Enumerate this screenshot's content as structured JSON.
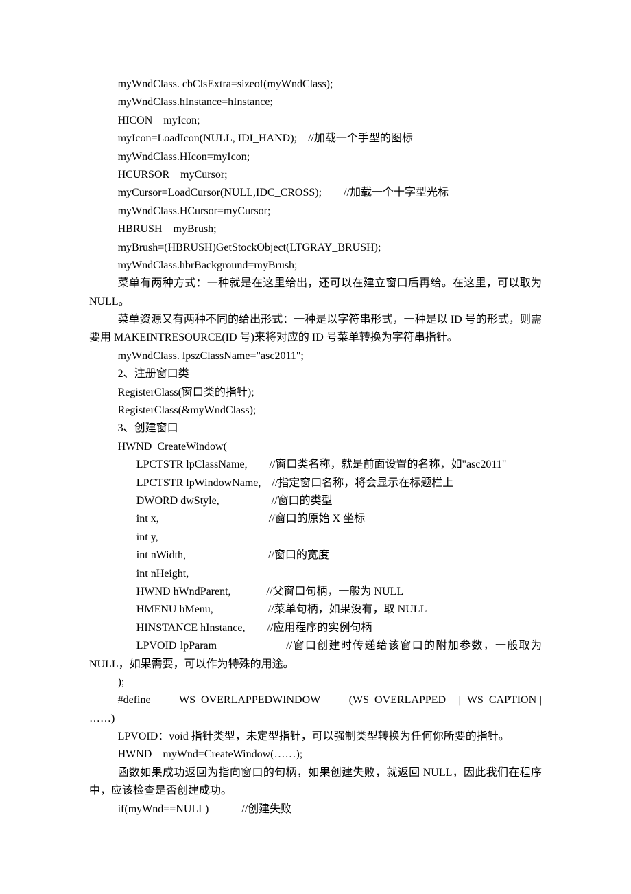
{
  "lines": [
    {
      "t": "myWndClass. cbClsExtra=sizeof(myWndClass);",
      "cls": "indent1"
    },
    {
      "t": "myWndClass.hInstance=hInstance;",
      "cls": "indent1"
    },
    {
      "t": "HICON    myIcon;",
      "cls": "indent1"
    },
    {
      "t": "myIcon=LoadIcon(NULL, IDI_HAND);    //加载一个手型的图标",
      "cls": "indent1"
    },
    {
      "t": "myWndClass.HIcon=myIcon;",
      "cls": "indent1"
    },
    {
      "t": "HCURSOR    myCursor;",
      "cls": "indent1"
    },
    {
      "t": "myCursor=LoadCursor(NULL,IDC_CROSS);        //加载一个十字型光标",
      "cls": "indent1"
    },
    {
      "t": "myWndClass.HCursor=myCursor;",
      "cls": "indent1"
    },
    {
      "t": "HBRUSH    myBrush;",
      "cls": "indent1"
    },
    {
      "t": "myBrush=(HBRUSH)GetStockObject(LTGRAY_BRUSH);",
      "cls": "indent1"
    },
    {
      "t": "myWndClass.hbrBackground=myBrush;",
      "cls": "indent1"
    },
    {
      "t": "菜单有两种方式：一种就是在这里给出，还可以在建立窗口后再给。在这里，可以取为 NULL。",
      "cls": "indent1 wrap"
    },
    {
      "t": "菜单资源又有两种不同的给出形式：一种是以字符串形式，一种是以 ID 号的形式，则需要用 MAKEINTRESOURCE(ID 号)来将对应的 ID 号菜单转换为字符串指针。",
      "cls": "indent1 wrap"
    },
    {
      "t": "myWndClass. lpszClassName=\"asc2011\";",
      "cls": "indent1"
    },
    {
      "t": "2、注册窗口类",
      "cls": "indent1"
    },
    {
      "t": "RegisterClass(窗口类的指针);",
      "cls": "indent1"
    },
    {
      "t": "RegisterClass(&myWndClass);",
      "cls": "indent1"
    },
    {
      "t": "3、创建窗口",
      "cls": "indent1"
    },
    {
      "t": "HWND  CreateWindow(",
      "cls": "indent1"
    },
    {
      "t": "LPCTSTR lpClassName,        //窗口类名称，就是前面设置的名称，如\"asc2011\"",
      "cls": "indent2 wrap"
    },
    {
      "t": "LPCTSTR lpWindowName,    //指定窗口名称，将会显示在标题栏上",
      "cls": "indent2"
    },
    {
      "t": "DWORD dwStyle,                   //窗口的类型",
      "cls": "indent2"
    },
    {
      "t": "int x,                                        //窗口的原始 X 坐标",
      "cls": "indent2"
    },
    {
      "t": "int y,",
      "cls": "indent2"
    },
    {
      "t": "int nWidth,                              //窗口的宽度",
      "cls": "indent2"
    },
    {
      "t": "int nHeight,",
      "cls": "indent2"
    },
    {
      "t": "HWND hWndParent,             //父窗口句柄，一般为 NULL",
      "cls": "indent2"
    },
    {
      "t": "HMENU hMenu,                    //菜单句柄，如果没有，取 NULL",
      "cls": "indent2"
    },
    {
      "t": "HINSTANCE hInstance,        //应用程序的实例句柄",
      "cls": "indent2"
    },
    {
      "t": "LPVOID lpParam                   //窗口创建时传递给该窗口的附加参数，一般取为 NULL，如果需要，可以作为特殊的用途。",
      "cls": "indent2 wrap"
    },
    {
      "t": ");",
      "cls": "indent1"
    },
    {
      "t": "#define         WS_OVERLAPPEDWINDOW         (WS_OVERLAPPED    |  WS_CAPTION |  ……)",
      "cls": "indent1 wrap"
    },
    {
      "t": "LPVOID：void 指针类型，未定型指针，可以强制类型转换为任何你所要的指针。",
      "cls": "indent1 wrap"
    },
    {
      "t": "HWND    myWnd=CreateWindow(……);",
      "cls": "indent1"
    },
    {
      "t": "函数如果成功返回为指向窗口的句柄，如果创建失败，就返回 NULL，因此我们在程序中，应该检查是否创建成功。",
      "cls": "indent1 wrap"
    },
    {
      "t": "if(myWnd==NULL)            //创建失败",
      "cls": "indent1"
    }
  ]
}
